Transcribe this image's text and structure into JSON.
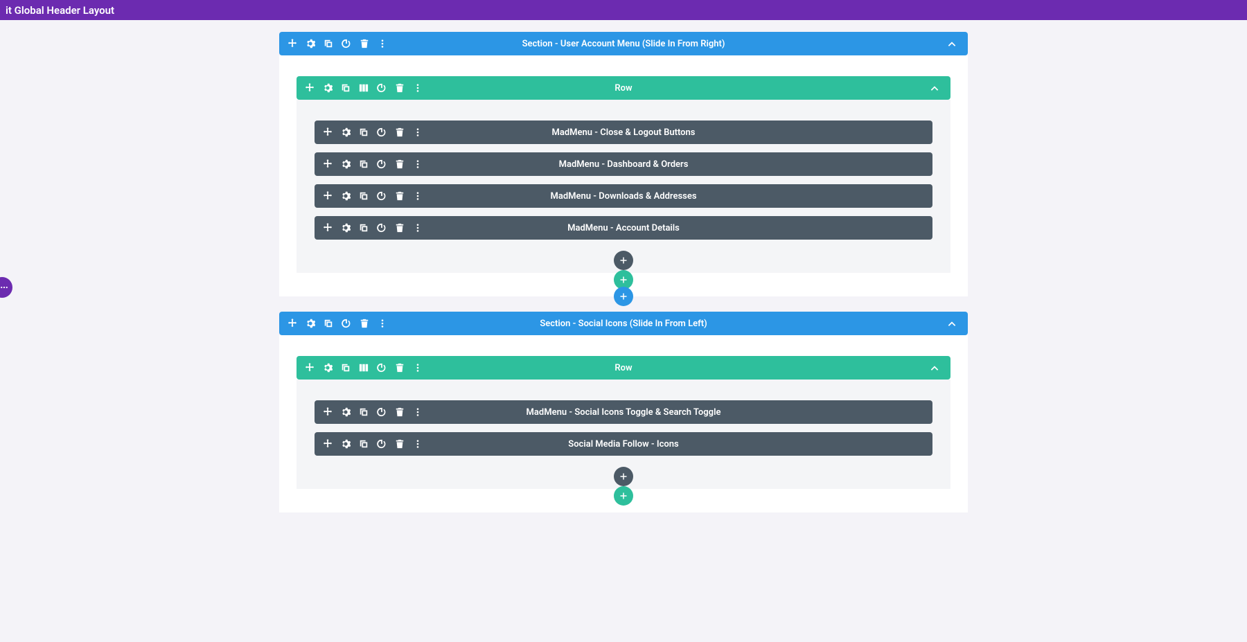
{
  "header": {
    "title": "it Global Header Layout"
  },
  "sections": [
    {
      "title": "Section - User Account Menu (Slide In From Right)",
      "rows": [
        {
          "title": "Row",
          "modules": [
            {
              "title": "MadMenu - Close & Logout Buttons"
            },
            {
              "title": "MadMenu - Dashboard & Orders"
            },
            {
              "title": "MadMenu - Downloads & Addresses"
            },
            {
              "title": "MadMenu - Account Details"
            }
          ]
        }
      ]
    },
    {
      "title": "Section - Social Icons (Slide In From Left)",
      "rows": [
        {
          "title": "Row",
          "modules": [
            {
              "title": "MadMenu - Social Icons Toggle & Search Toggle"
            },
            {
              "title": "Social Media Follow - Icons"
            }
          ]
        }
      ]
    }
  ]
}
